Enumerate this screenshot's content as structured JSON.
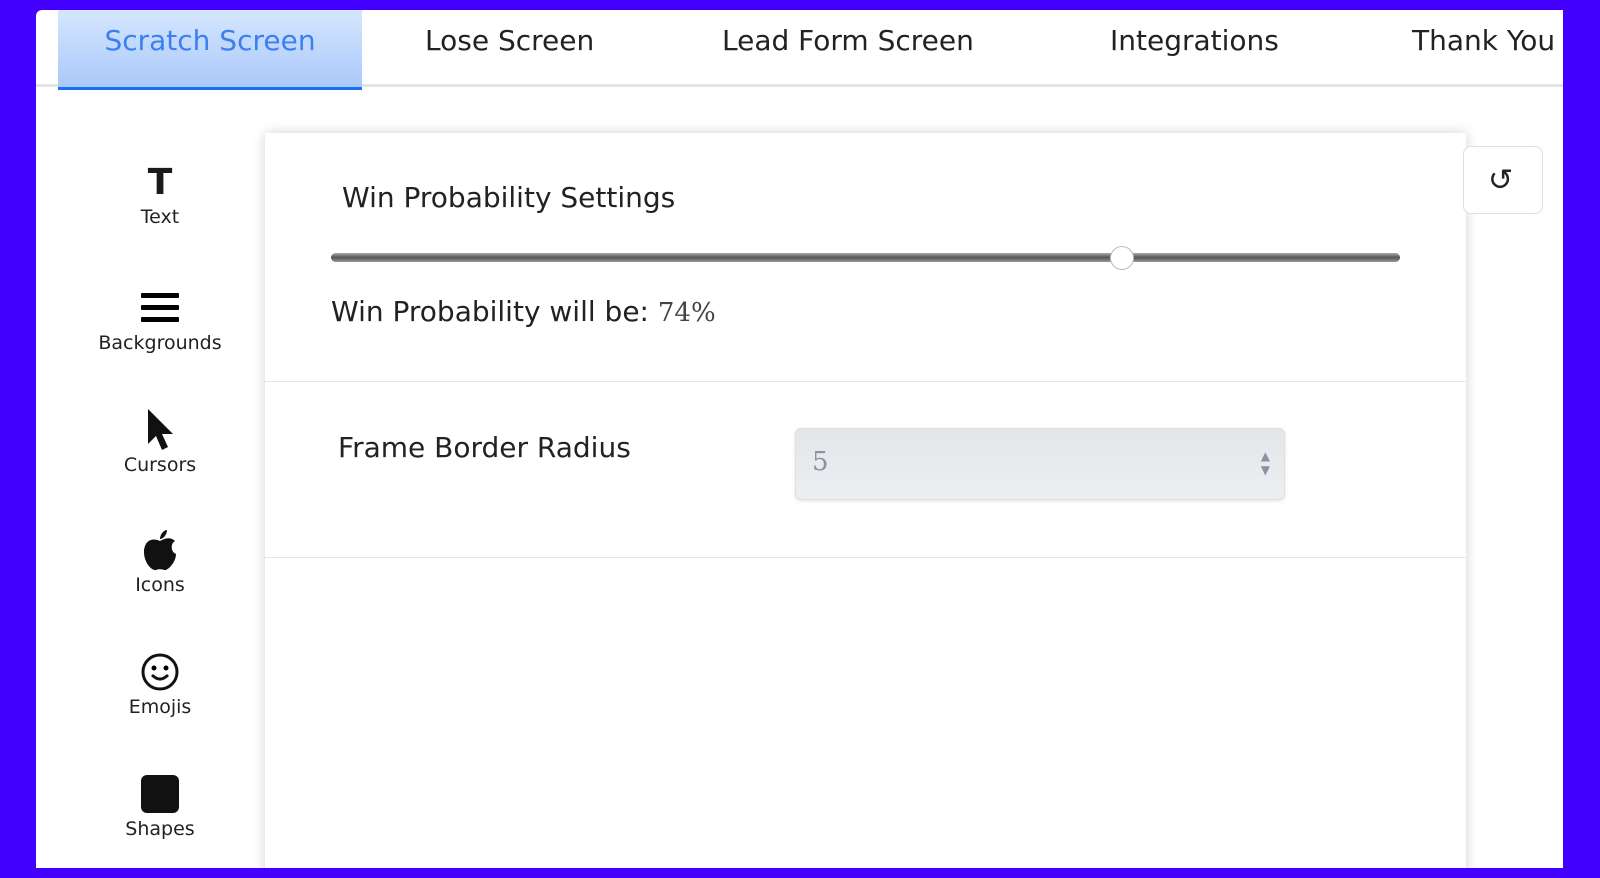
{
  "tabs": [
    {
      "label": "Scratch Screen",
      "active": true
    },
    {
      "label": "Lose Screen"
    },
    {
      "label": "Lead Form Screen"
    },
    {
      "label": "Integrations"
    },
    {
      "label": "Thank You"
    }
  ],
  "sidebar": {
    "items": [
      {
        "label": "Text",
        "icon": "text-icon"
      },
      {
        "label": "Backgrounds",
        "icon": "menu-icon"
      },
      {
        "label": "Cursors",
        "icon": "cursor-icon"
      },
      {
        "label": "Icons",
        "icon": "apple-icon"
      },
      {
        "label": "Emojis",
        "icon": "smiley-icon"
      },
      {
        "label": "Shapes",
        "icon": "square-icon"
      }
    ]
  },
  "settings": {
    "title": "Win Probability Settings",
    "probability_label": "Win Probability will be:",
    "probability_value": "74%",
    "probability_fraction": 0.74,
    "border_radius_label": "Frame Border Radius",
    "border_radius_value": "5"
  },
  "colors": {
    "background": "#4400ff",
    "active_tab": "#3b7ff0"
  }
}
